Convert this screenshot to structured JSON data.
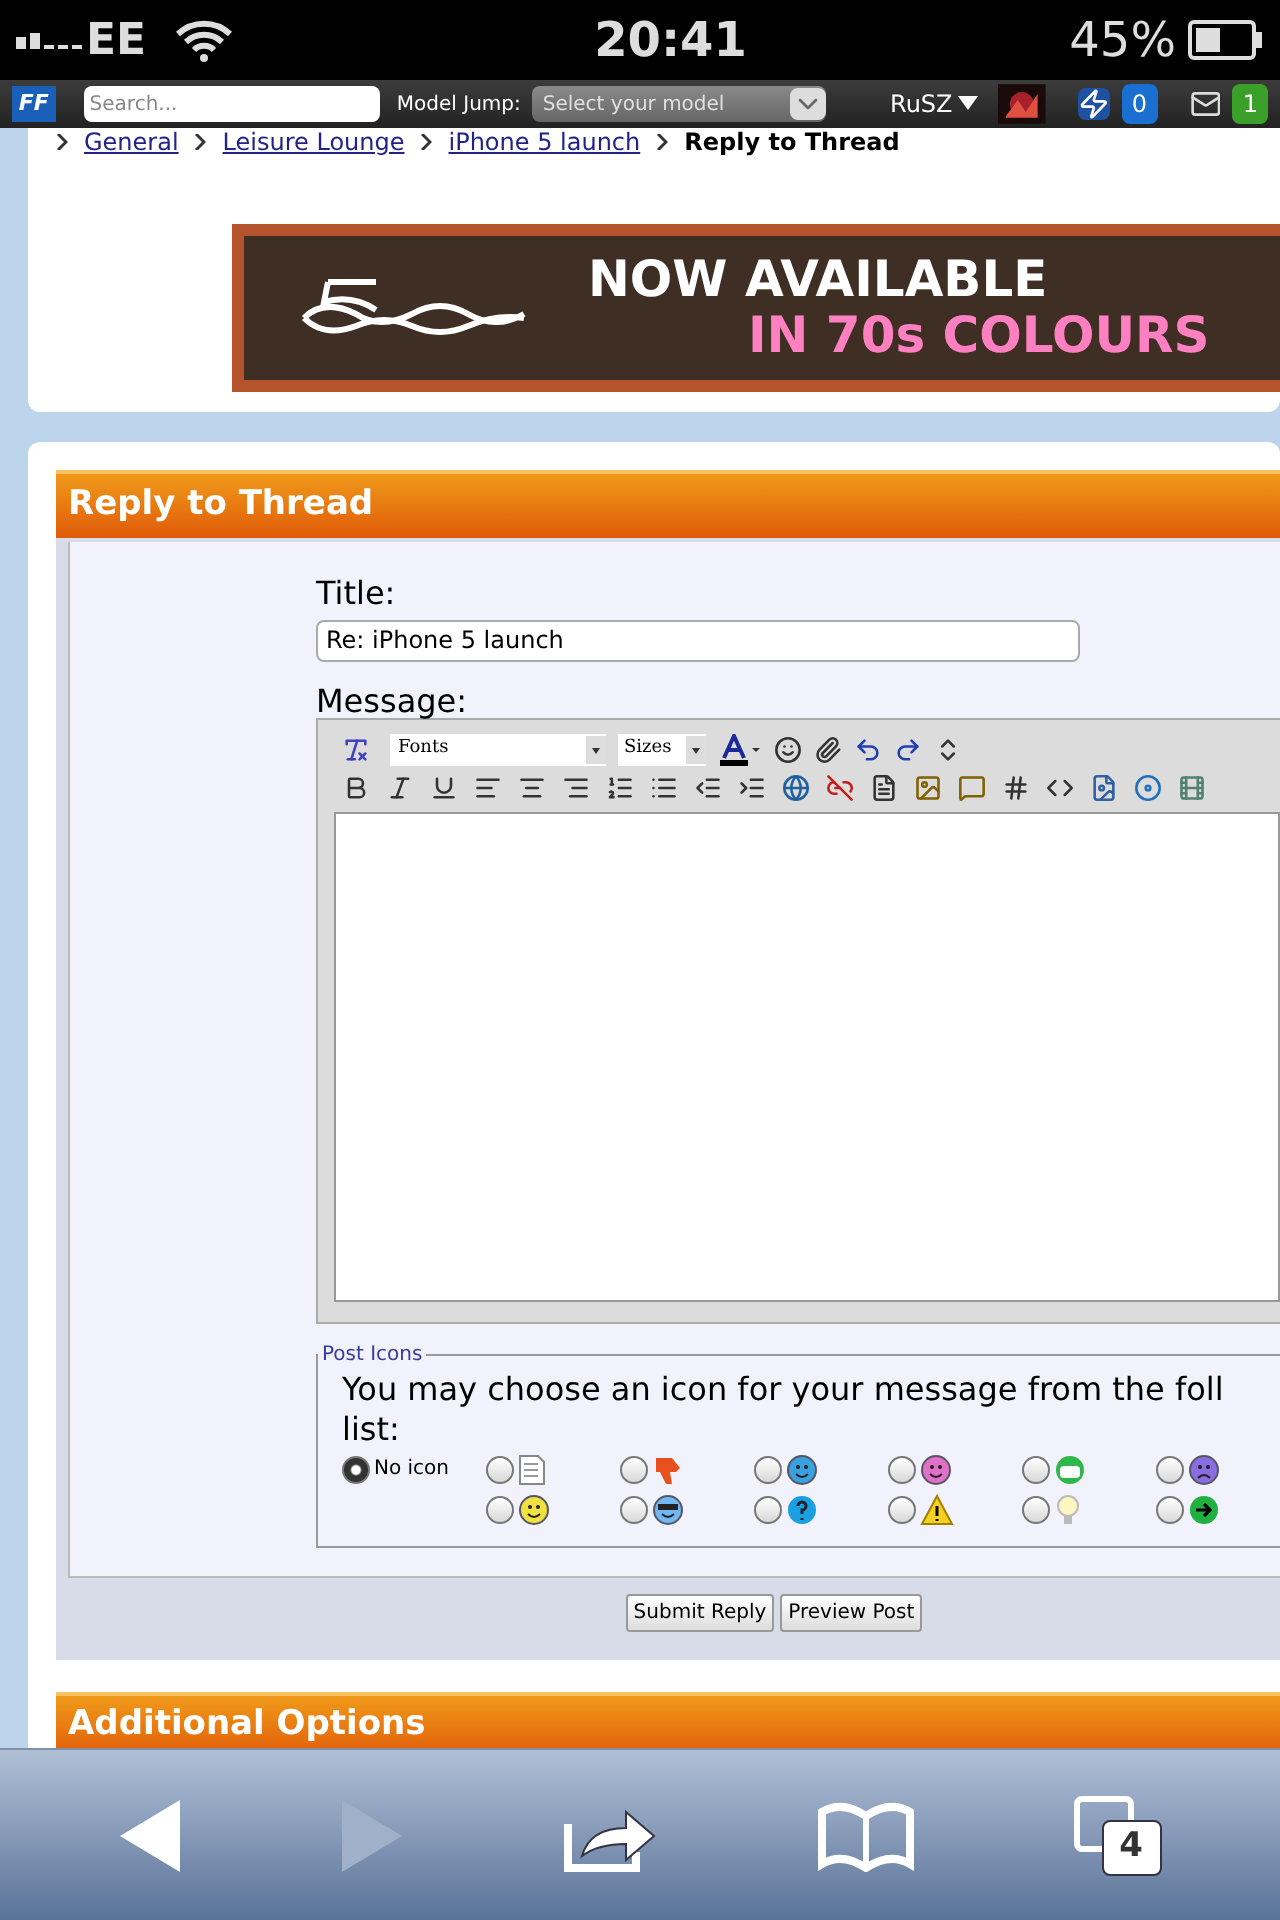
{
  "status_bar": {
    "carrier": "EE",
    "time": "20:41",
    "battery": "45%"
  },
  "forum_bar": {
    "logo": "FF",
    "search": {
      "placeholder": "Search..."
    },
    "model_jump": {
      "label": "Model Jump:",
      "value": "Select your model"
    },
    "user": "RuSZ",
    "notifications": "0",
    "messages": "1"
  },
  "breadcrumb": [
    {
      "label": "General",
      "link": true
    },
    {
      "label": "Leisure Lounge",
      "link": true
    },
    {
      "label": "iPhone 5 launch",
      "link": true
    },
    {
      "label": "Reply to Thread",
      "link": false
    }
  ],
  "banner": {
    "line_1": "NOW AVAILABLE",
    "line_2": "IN 70s COLOURS"
  },
  "reply": {
    "heading": "Reply to Thread",
    "title_label": "Title:",
    "title_value": "Re: iPhone 5 launch",
    "message_label": "Message:",
    "editor": {
      "font_select": "Fonts",
      "size_select": "Sizes"
    },
    "post_icons": {
      "legend": "Post Icons",
      "prompt_lines": [
        "You may choose an icon for your message from the foll",
        "list:"
      ],
      "options": [
        {
          "label": "No icon",
          "selected": true
        },
        {
          "selected": false
        },
        {
          "selected": false
        },
        {
          "selected": false
        },
        {
          "selected": false
        },
        {
          "selected": false
        },
        {
          "selected": false
        },
        {
          "selected": false
        },
        {
          "selected": false
        },
        {
          "selected": false
        },
        {
          "selected": false
        },
        {
          "selected": false
        },
        {
          "selected": false
        }
      ]
    },
    "buttons": [
      "Submit Reply",
      "Preview Post"
    ]
  },
  "additional": {
    "heading": "Additional Options"
  },
  "safari": {
    "tab_count": "4"
  }
}
